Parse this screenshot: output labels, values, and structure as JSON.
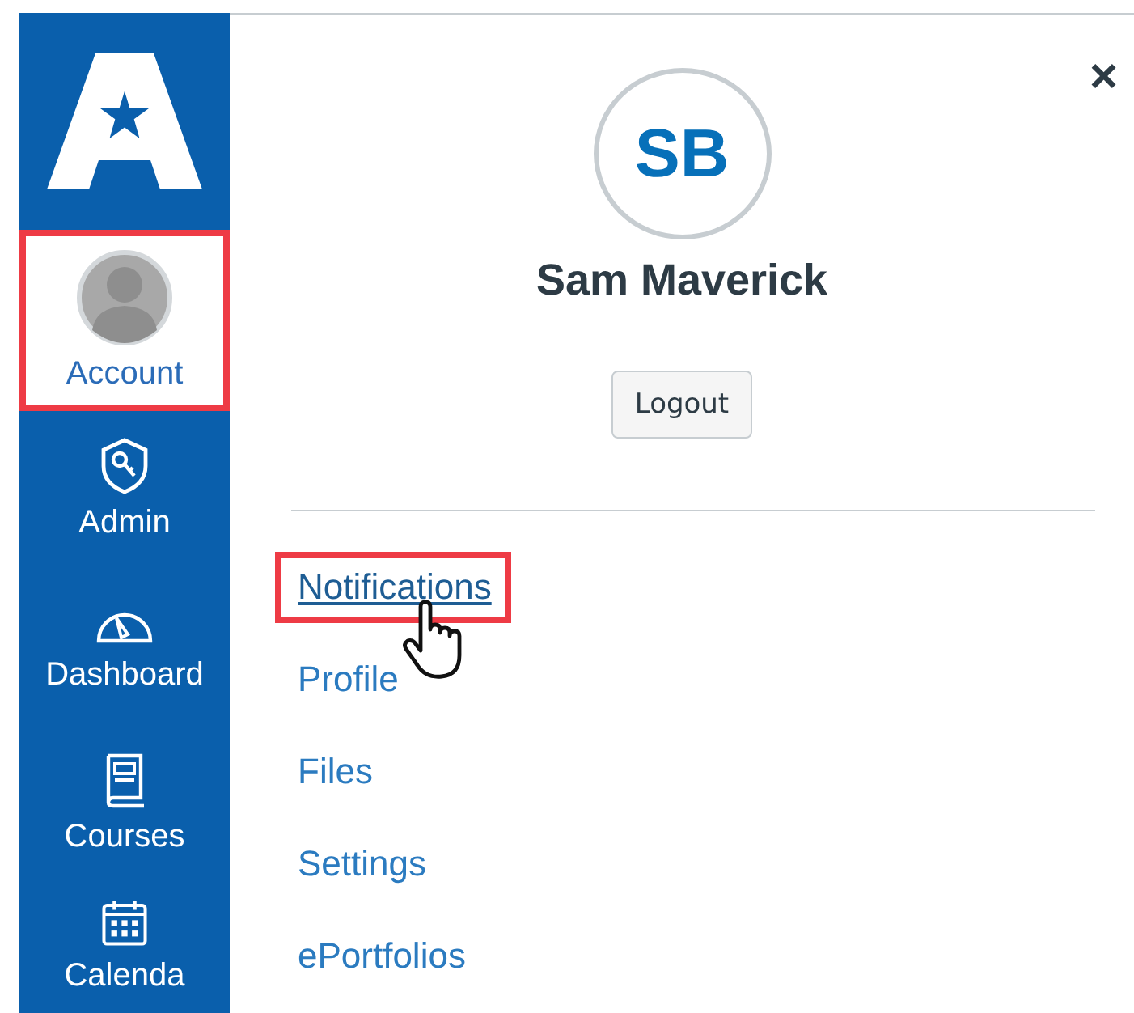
{
  "sidebar": {
    "items": [
      {
        "label": "Account",
        "selected": true,
        "highlighted": true
      },
      {
        "label": "Admin",
        "selected": false,
        "highlighted": false
      },
      {
        "label": "Dashboard",
        "selected": false,
        "highlighted": false
      },
      {
        "label": "Courses",
        "selected": false,
        "highlighted": false
      },
      {
        "label": "Calenda",
        "selected": false,
        "highlighted": false
      }
    ]
  },
  "panel": {
    "close": "×",
    "initials": "SB",
    "name": "Sam Maverick",
    "logout": "Logout",
    "links": [
      {
        "label": "Notifications",
        "hovered": true,
        "highlighted": true
      },
      {
        "label": "Profile",
        "hovered": false,
        "highlighted": false
      },
      {
        "label": "Files",
        "hovered": false,
        "highlighted": false
      },
      {
        "label": "Settings",
        "hovered": false,
        "highlighted": false
      },
      {
        "label": "ePortfolios",
        "hovered": false,
        "highlighted": false
      }
    ]
  }
}
